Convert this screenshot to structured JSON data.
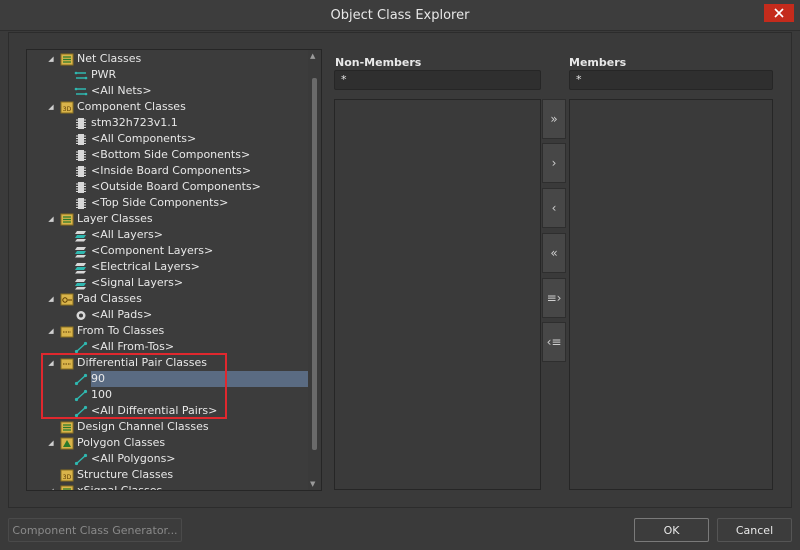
{
  "window": {
    "title": "Object Class Explorer"
  },
  "tree": {
    "items": [
      {
        "level": 0,
        "expanded": true,
        "icon": "class-folder-icon",
        "label": "Net Classes"
      },
      {
        "level": 1,
        "icon": "net-icon",
        "label": "PWR"
      },
      {
        "level": 1,
        "icon": "net-icon",
        "label": "<All Nets>"
      },
      {
        "level": 0,
        "expanded": true,
        "icon": "component-folder-icon",
        "label": "Component Classes"
      },
      {
        "level": 1,
        "icon": "component-icon",
        "label": "stm32h723v1.1"
      },
      {
        "level": 1,
        "icon": "component-icon",
        "label": "<All Components>"
      },
      {
        "level": 1,
        "icon": "component-icon",
        "label": "<Bottom Side Components>"
      },
      {
        "level": 1,
        "icon": "component-icon",
        "label": "<Inside Board Components>"
      },
      {
        "level": 1,
        "icon": "component-icon",
        "label": "<Outside Board Components>"
      },
      {
        "level": 1,
        "icon": "component-icon",
        "label": "<Top Side Components>"
      },
      {
        "level": 0,
        "expanded": true,
        "icon": "class-folder-icon",
        "label": "Layer Classes"
      },
      {
        "level": 1,
        "icon": "layer-icon",
        "label": "<All Layers>"
      },
      {
        "level": 1,
        "icon": "layer-icon",
        "label": "<Component Layers>"
      },
      {
        "level": 1,
        "icon": "layer-icon",
        "label": "<Electrical Layers>"
      },
      {
        "level": 1,
        "icon": "layer-icon",
        "label": "<Signal Layers>"
      },
      {
        "level": 0,
        "expanded": true,
        "icon": "pad-folder-icon",
        "label": "Pad Classes"
      },
      {
        "level": 1,
        "icon": "pad-icon",
        "label": "<All Pads>"
      },
      {
        "level": 0,
        "expanded": true,
        "icon": "fromto-folder-icon",
        "label": "From To Classes"
      },
      {
        "level": 1,
        "icon": "diff-pair-icon",
        "label": "<All From-Tos>"
      },
      {
        "level": 0,
        "expanded": true,
        "icon": "fromto-folder-icon",
        "label": "Differential Pair Classes"
      },
      {
        "level": 1,
        "icon": "diff-pair-icon",
        "label": "90",
        "selected": true
      },
      {
        "level": 1,
        "icon": "diff-pair-icon",
        "label": "100"
      },
      {
        "level": 1,
        "icon": "diff-pair-icon",
        "label": "<All Differential Pairs>"
      },
      {
        "level": 0,
        "expanded": false,
        "icon": "class-folder-icon",
        "label": "Design Channel Classes"
      },
      {
        "level": 0,
        "expanded": true,
        "icon": "polygon-folder-icon",
        "label": "Polygon Classes"
      },
      {
        "level": 1,
        "icon": "diff-pair-icon",
        "label": "<All Polygons>"
      },
      {
        "level": 0,
        "expanded": false,
        "icon": "component-folder-icon",
        "label": "Structure Classes"
      },
      {
        "level": 0,
        "expanded": true,
        "icon": "class-folder-icon",
        "label": "xSignal Classes"
      }
    ]
  },
  "non_members": {
    "label": "Non-Members",
    "filter": "*"
  },
  "members": {
    "label": "Members",
    "filter": "*"
  },
  "move_buttons": [
    {
      "name": "add-all-button",
      "glyph": "»"
    },
    {
      "name": "add-button",
      "glyph": "›"
    },
    {
      "name": "remove-button",
      "glyph": "‹"
    },
    {
      "name": "remove-all-button",
      "glyph": "«"
    },
    {
      "name": "add-selected-button",
      "glyph": "≡›"
    },
    {
      "name": "remove-selected-button",
      "glyph": "‹≡"
    }
  ],
  "footer": {
    "generator_label": "Component Class Generator...",
    "ok_label": "OK",
    "cancel_label": "Cancel"
  },
  "colors": {
    "selection": "#5a6b82",
    "highlight_box": "#e0282e",
    "close_button": "#c42b1c",
    "icon_teal": "#2fb8b0",
    "folder_yellow": "#d9b44a"
  }
}
